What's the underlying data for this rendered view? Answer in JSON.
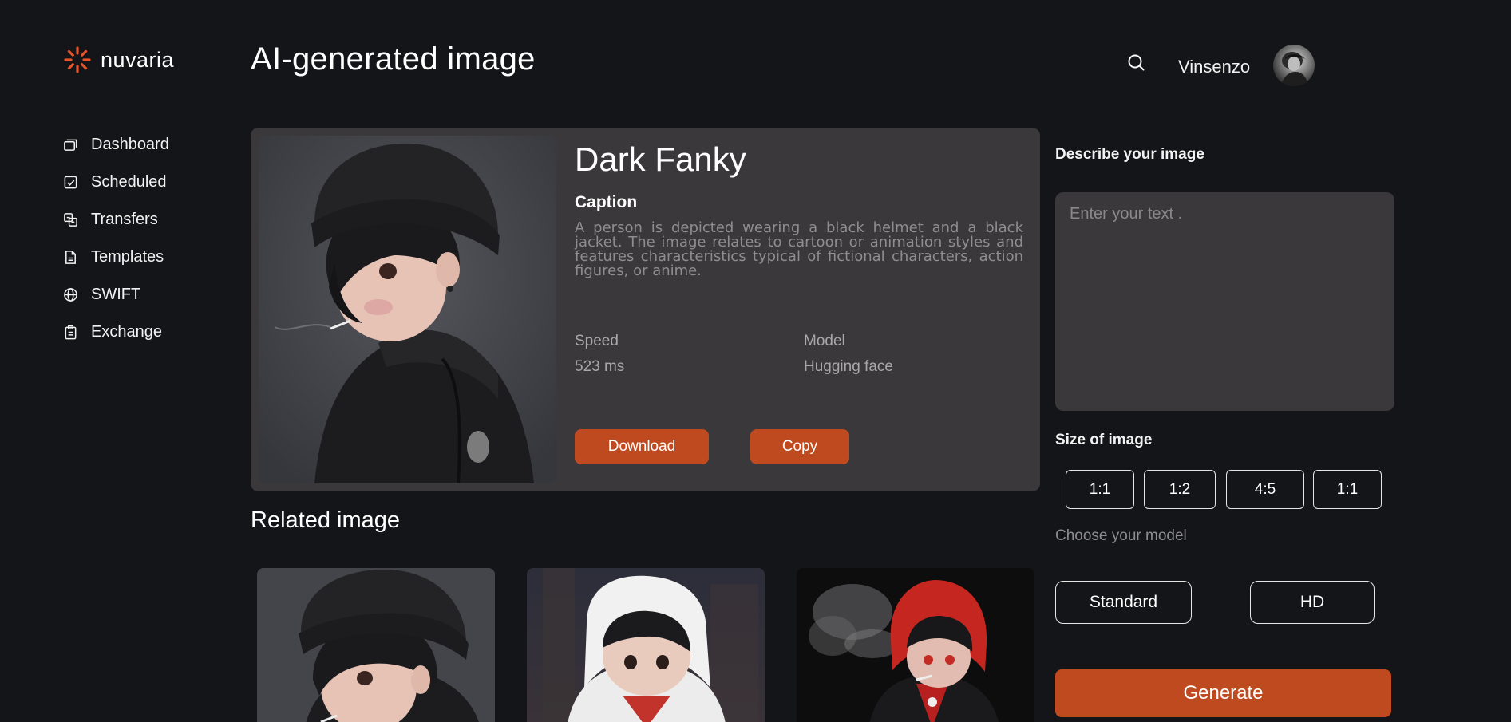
{
  "brand": {
    "name": "nuvaria",
    "accent": "#e5542a"
  },
  "sidebar": {
    "items": [
      {
        "label": "Dashboard",
        "icon": "cards-icon"
      },
      {
        "label": "Scheduled",
        "icon": "checkbox-icon"
      },
      {
        "label": "Transfers",
        "icon": "transfer-icon"
      },
      {
        "label": "Templates",
        "icon": "document-icon"
      },
      {
        "label": "SWIFT",
        "icon": "globe-icon"
      },
      {
        "label": "Exchange",
        "icon": "clipboard-icon"
      }
    ]
  },
  "header": {
    "title": "AI-generated image",
    "user_name": "Vinsenzo",
    "search_icon": "search-icon"
  },
  "detail": {
    "title": "Dark Fanky",
    "caption_heading": "Caption",
    "caption": "A person is depicted wearing a black helmet and a black jacket. The image relates to cartoon or animation styles and features characteristics typical of fictional characters, action figures, or anime.",
    "speed_label": "Speed",
    "speed_value": "523 ms",
    "model_label": "Model",
    "model_value": "Hugging face",
    "download_label": "Download",
    "copy_label": "Copy"
  },
  "related": {
    "title": "Related image"
  },
  "panel": {
    "describe_label": "Describe your image",
    "describe_placeholder": "Enter your text .",
    "size_label": "Size of image",
    "sizes": [
      "1:1",
      "1:2",
      "4:5",
      "1:1"
    ],
    "choose_model_label": "Choose your model",
    "models": [
      "Standard",
      "HD"
    ],
    "generate_label": "Generate"
  },
  "colors": {
    "background": "#141518",
    "card": "#3a383a",
    "button": "#c04a1f"
  }
}
